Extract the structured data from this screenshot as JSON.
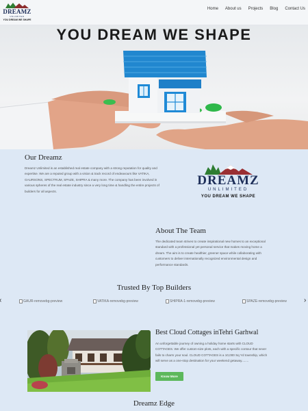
{
  "header": {
    "logo": {
      "brand": "DREAMZ",
      "sub": "UNLIMITED",
      "tagline": "YOU DREAM WE SHAPE"
    },
    "nav": [
      "Home",
      "About us",
      "Projects",
      "Blog",
      "Contact Us"
    ]
  },
  "hero": {
    "title": "YOU DREAM WE SHAPE"
  },
  "our_dreamz": {
    "title": "Our Dreamz",
    "lines": [
      "Dreamz Unlimited is an established real estate company with a strong reputation for quality and",
      "expertise. We are a reputed group with a vision & track record of endeavours like VATIKA,",
      "GAURSONS, SPECTRUM, SPAZE, SHIPRA & many more. The company has been involved in",
      "various spheres of the real estate industry since a very long time & handling the entire projects of",
      "builders for all aspects."
    ],
    "logo": {
      "brand": "DREAMZ",
      "sub": "UNLIMITED",
      "tagline": "YOU DREAM WE SHAPE"
    }
  },
  "team": {
    "title": "About The Team",
    "lines": [
      "The dedicated team strives to create inspirational new homes to an exceptional",
      "standard with a professional yet personal service that makes moving home a",
      "dream. The aim is to create healthier, greener space while collaborating with",
      "customers to deliver internationally recognized environmental design and",
      "performance standards."
    ]
  },
  "builders": {
    "title": "Trusted By Top Builders",
    "items": [
      "GAUR-removebg-preview",
      "VATIKA-removebg-preview",
      "SHIPRA-1-removebg-preview",
      "SPAZE-removebg-preview"
    ],
    "prev": "‹",
    "next": "›"
  },
  "cottages": {
    "title": "Best Cloud Cottages inTehri Garhwal",
    "lines": [
      "An unforgettable journey of owning a holiday home starts with CLOUD",
      "COTTAGES. We offer custom-size plots, each with a specific contour that never",
      "fails to charm your soul. CLOUD COTTAGES is a 10,000 Sq Yd township, which",
      "will serve as a one-stop destination for your weekend getaway........"
    ],
    "button": "Know More"
  },
  "edge": {
    "title": "Dreamz Edge"
  }
}
